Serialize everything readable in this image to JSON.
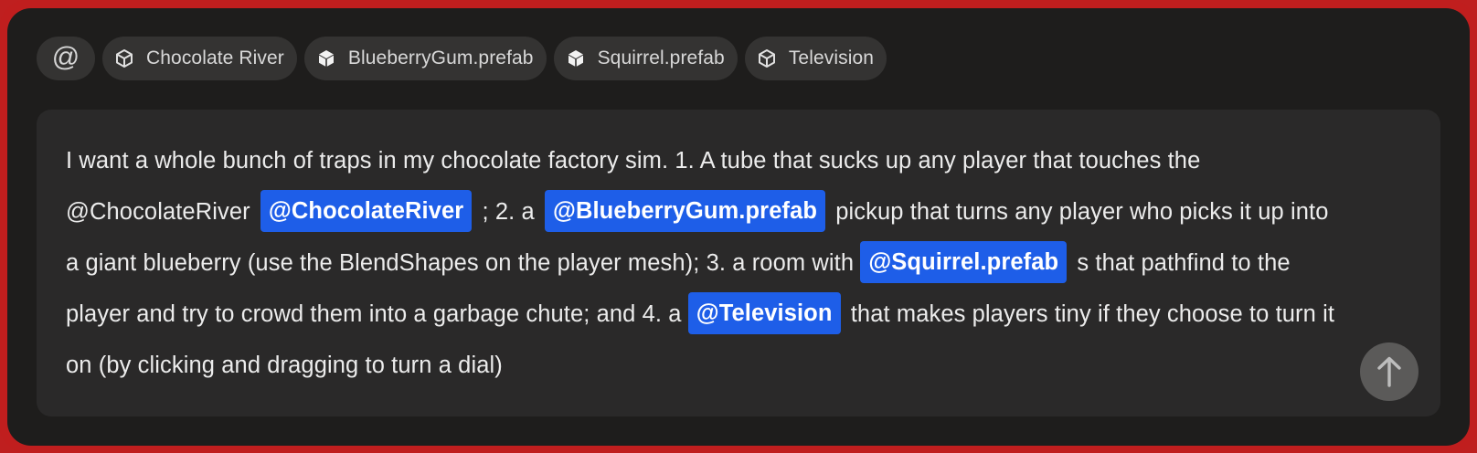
{
  "context_chips": {
    "mention_icon": "at-sign-icon",
    "items": [
      {
        "icon": "cube-outline-icon",
        "label": "Chocolate River"
      },
      {
        "icon": "cube-filled-icon",
        "label": "BlueberryGum.prefab"
      },
      {
        "icon": "cube-filled-icon",
        "label": "Squirrel.prefab"
      },
      {
        "icon": "cube-outline-icon",
        "label": "Television"
      }
    ]
  },
  "prompt": {
    "segments": {
      "s1": "I want a whole bunch of traps in my chocolate factory sim. 1. A tube that sucks up any player that touches the @ChocolateRiver",
      "m1": "@ChocolateRiver",
      "s2": "; 2. a",
      "m2": "@BlueberryGum.prefab",
      "s3": "pickup that turns any player who picks it up into a giant blueberry (use the BlendShapes on the player mesh); 3. a room with",
      "m3": "@Squirrel.prefab",
      "s4": "s that pathfind to the player and try to crowd them into a garbage chute; and 4. a",
      "m4": "@Television",
      "s5": "that makes players tiny if they choose to turn it on (by clicking and dragging to turn a dial)"
    }
  },
  "send_button": {
    "icon": "arrow-up-icon"
  },
  "colors": {
    "frame_border": "#c01e1e",
    "panel_bg": "#1e1d1c",
    "chip_bg": "#343332",
    "prompt_bg": "#2a2929",
    "mention_bg": "#1e5ee8",
    "send_bg": "#5b5a59"
  }
}
